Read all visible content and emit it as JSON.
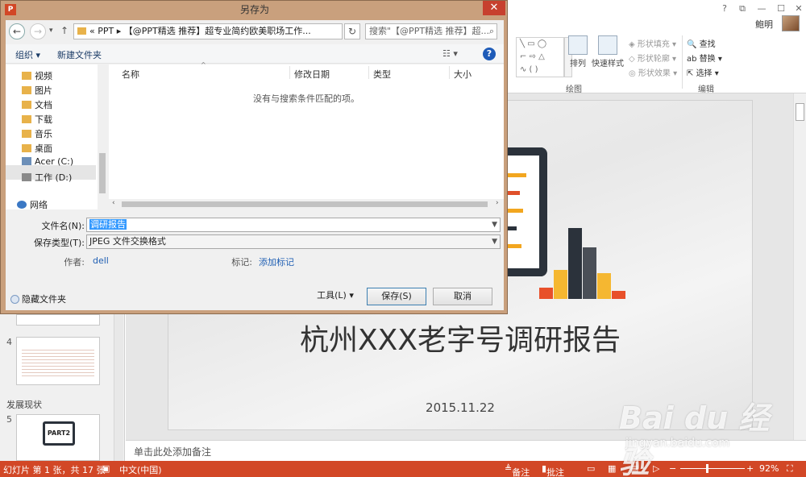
{
  "ppt": {
    "window_controls": {
      "help": "?",
      "restore": "⧉",
      "minimize": "—",
      "maximize": "☐",
      "close": "✕"
    },
    "user": {
      "name": "鲍明"
    },
    "ribbon": {
      "arrange_label": "排列",
      "quick_styles_label": "快速样式",
      "shape_fill": "形状填充",
      "shape_outline": "形状轮廓",
      "shape_effects": "形状效果",
      "find": "查找",
      "replace": "替换",
      "select": "选择",
      "group_drawing": "绘图",
      "group_editing": "编辑"
    },
    "thumbnails": {
      "slide4_num": "4",
      "section_name": "发展现状",
      "slide5_num": "5",
      "slide5_text": "PART2"
    },
    "slide": {
      "title": "杭州XXX老字号调研报告",
      "date": "2015.11.22"
    },
    "notes_placeholder": "单击此处添加备注",
    "statusbar": {
      "slide_info": "幻灯片 第 1 张，共 17 张",
      "language": "中文(中国)",
      "notes": "备注",
      "comments": "批注",
      "zoom_minus": "−",
      "zoom_plus": "+",
      "zoom": "92%"
    },
    "watermark": {
      "logo": "Bai du 经验",
      "url": "jingyan.baidu.com"
    }
  },
  "dialog": {
    "title": "另存为",
    "app_icon": "P",
    "close": "✕",
    "nav": {
      "back": "←",
      "forward": "→",
      "down": "▾",
      "up": "↑"
    },
    "address": "« PPT ▸ 【@PPT精选 推荐】超专业简约欧美职场工作...",
    "refresh": "↻",
    "search_placeholder": "搜索\"【@PPT精选 推荐】超...",
    "toolbar": {
      "organize": "组织 ▾",
      "new_folder": "新建文件夹",
      "view": "☷ ▾",
      "help": "?"
    },
    "nav_items": [
      {
        "label": "视频",
        "color": "#e8b24a"
      },
      {
        "label": "图片",
        "color": "#e8b24a"
      },
      {
        "label": "文档",
        "color": "#e8b24a"
      },
      {
        "label": "下载",
        "color": "#e8b24a"
      },
      {
        "label": "音乐",
        "color": "#e8b24a"
      },
      {
        "label": "桌面",
        "color": "#e8b24a"
      },
      {
        "label": "Acer (C:)",
        "color": "#6c8fb8"
      },
      {
        "label": "工作 (D:)",
        "color": "#8a8a8a"
      },
      {
        "label": "网络",
        "color": "#3b78c4"
      }
    ],
    "columns": {
      "name": "名称",
      "modified": "修改日期",
      "type": "类型",
      "size": "大小"
    },
    "empty_message": "没有与搜索条件匹配的项。",
    "form": {
      "filename_label": "文件名(N):",
      "filename_value": "调研报告",
      "filetype_label": "保存类型(T):",
      "filetype_value": "JPEG 文件交换格式",
      "author_label": "作者:",
      "author_value": "dell",
      "tags_label": "标记:",
      "tags_value": "添加标记"
    },
    "buttons": {
      "tools": "工具(L)  ▾",
      "save": "保存(S)",
      "cancel": "取消"
    },
    "hide_folders": "隐藏文件夹"
  },
  "colors": {
    "accent": "#d24726",
    "dialog_frame": "#c9a07d",
    "link": "#1f5fb3"
  }
}
